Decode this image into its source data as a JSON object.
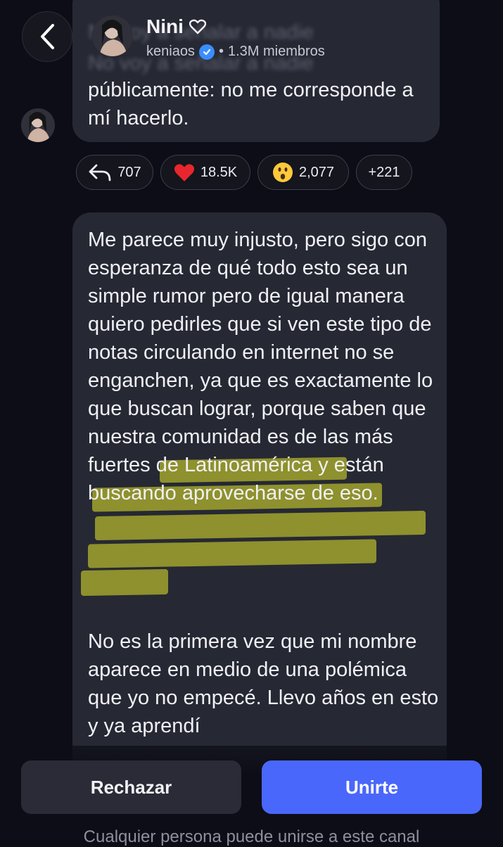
{
  "header": {
    "title": "Nini",
    "handle": "keniaos",
    "members": "1.3M miembros",
    "icons": {
      "back": "chevron-left-icon",
      "heart": "heart-outline-icon",
      "verified": "verified-badge-icon"
    }
  },
  "message1": {
    "blurred_lines": [
      "No voy a señalar a nadie",
      "No voy a señalar a nadie"
    ],
    "text": "públicamente: no me corresponde a mí hacerlo."
  },
  "reactions": [
    {
      "icon": "reply-icon",
      "count": "707"
    },
    {
      "icon": "red-heart-emoji",
      "count": "18.5K"
    },
    {
      "icon": "surprised-face-emoji",
      "count": "2,077"
    },
    {
      "icon": "",
      "count": "+221"
    }
  ],
  "message2": {
    "p1_before": "Me parece muy injusto, pero sigo con esperanza de qué todo esto sea un simple rumor pero de igual manera quiero pedirles que si ven este tipo de notas circulando en internet no se enganchen, ya que es exactamente lo que buscan lograr, p",
    "p1_highlight": "orque saben que nuestra comunidad es de las más fuertes de Latinoamérica y están buscando aprovecharse de eso.",
    "p2": "No es la primera vez que mi nombre aparece en medio de una polémica que yo no empecé. Llevo años en esto y ya aprendí"
  },
  "actions": {
    "reject": "Rechazar",
    "join": "Unirte"
  },
  "footer": "Cualquier persona puede unirse a este canal",
  "colors": {
    "accent": "#4a67fb",
    "highlight": "#e4e828",
    "verified": "#3a8dff"
  }
}
